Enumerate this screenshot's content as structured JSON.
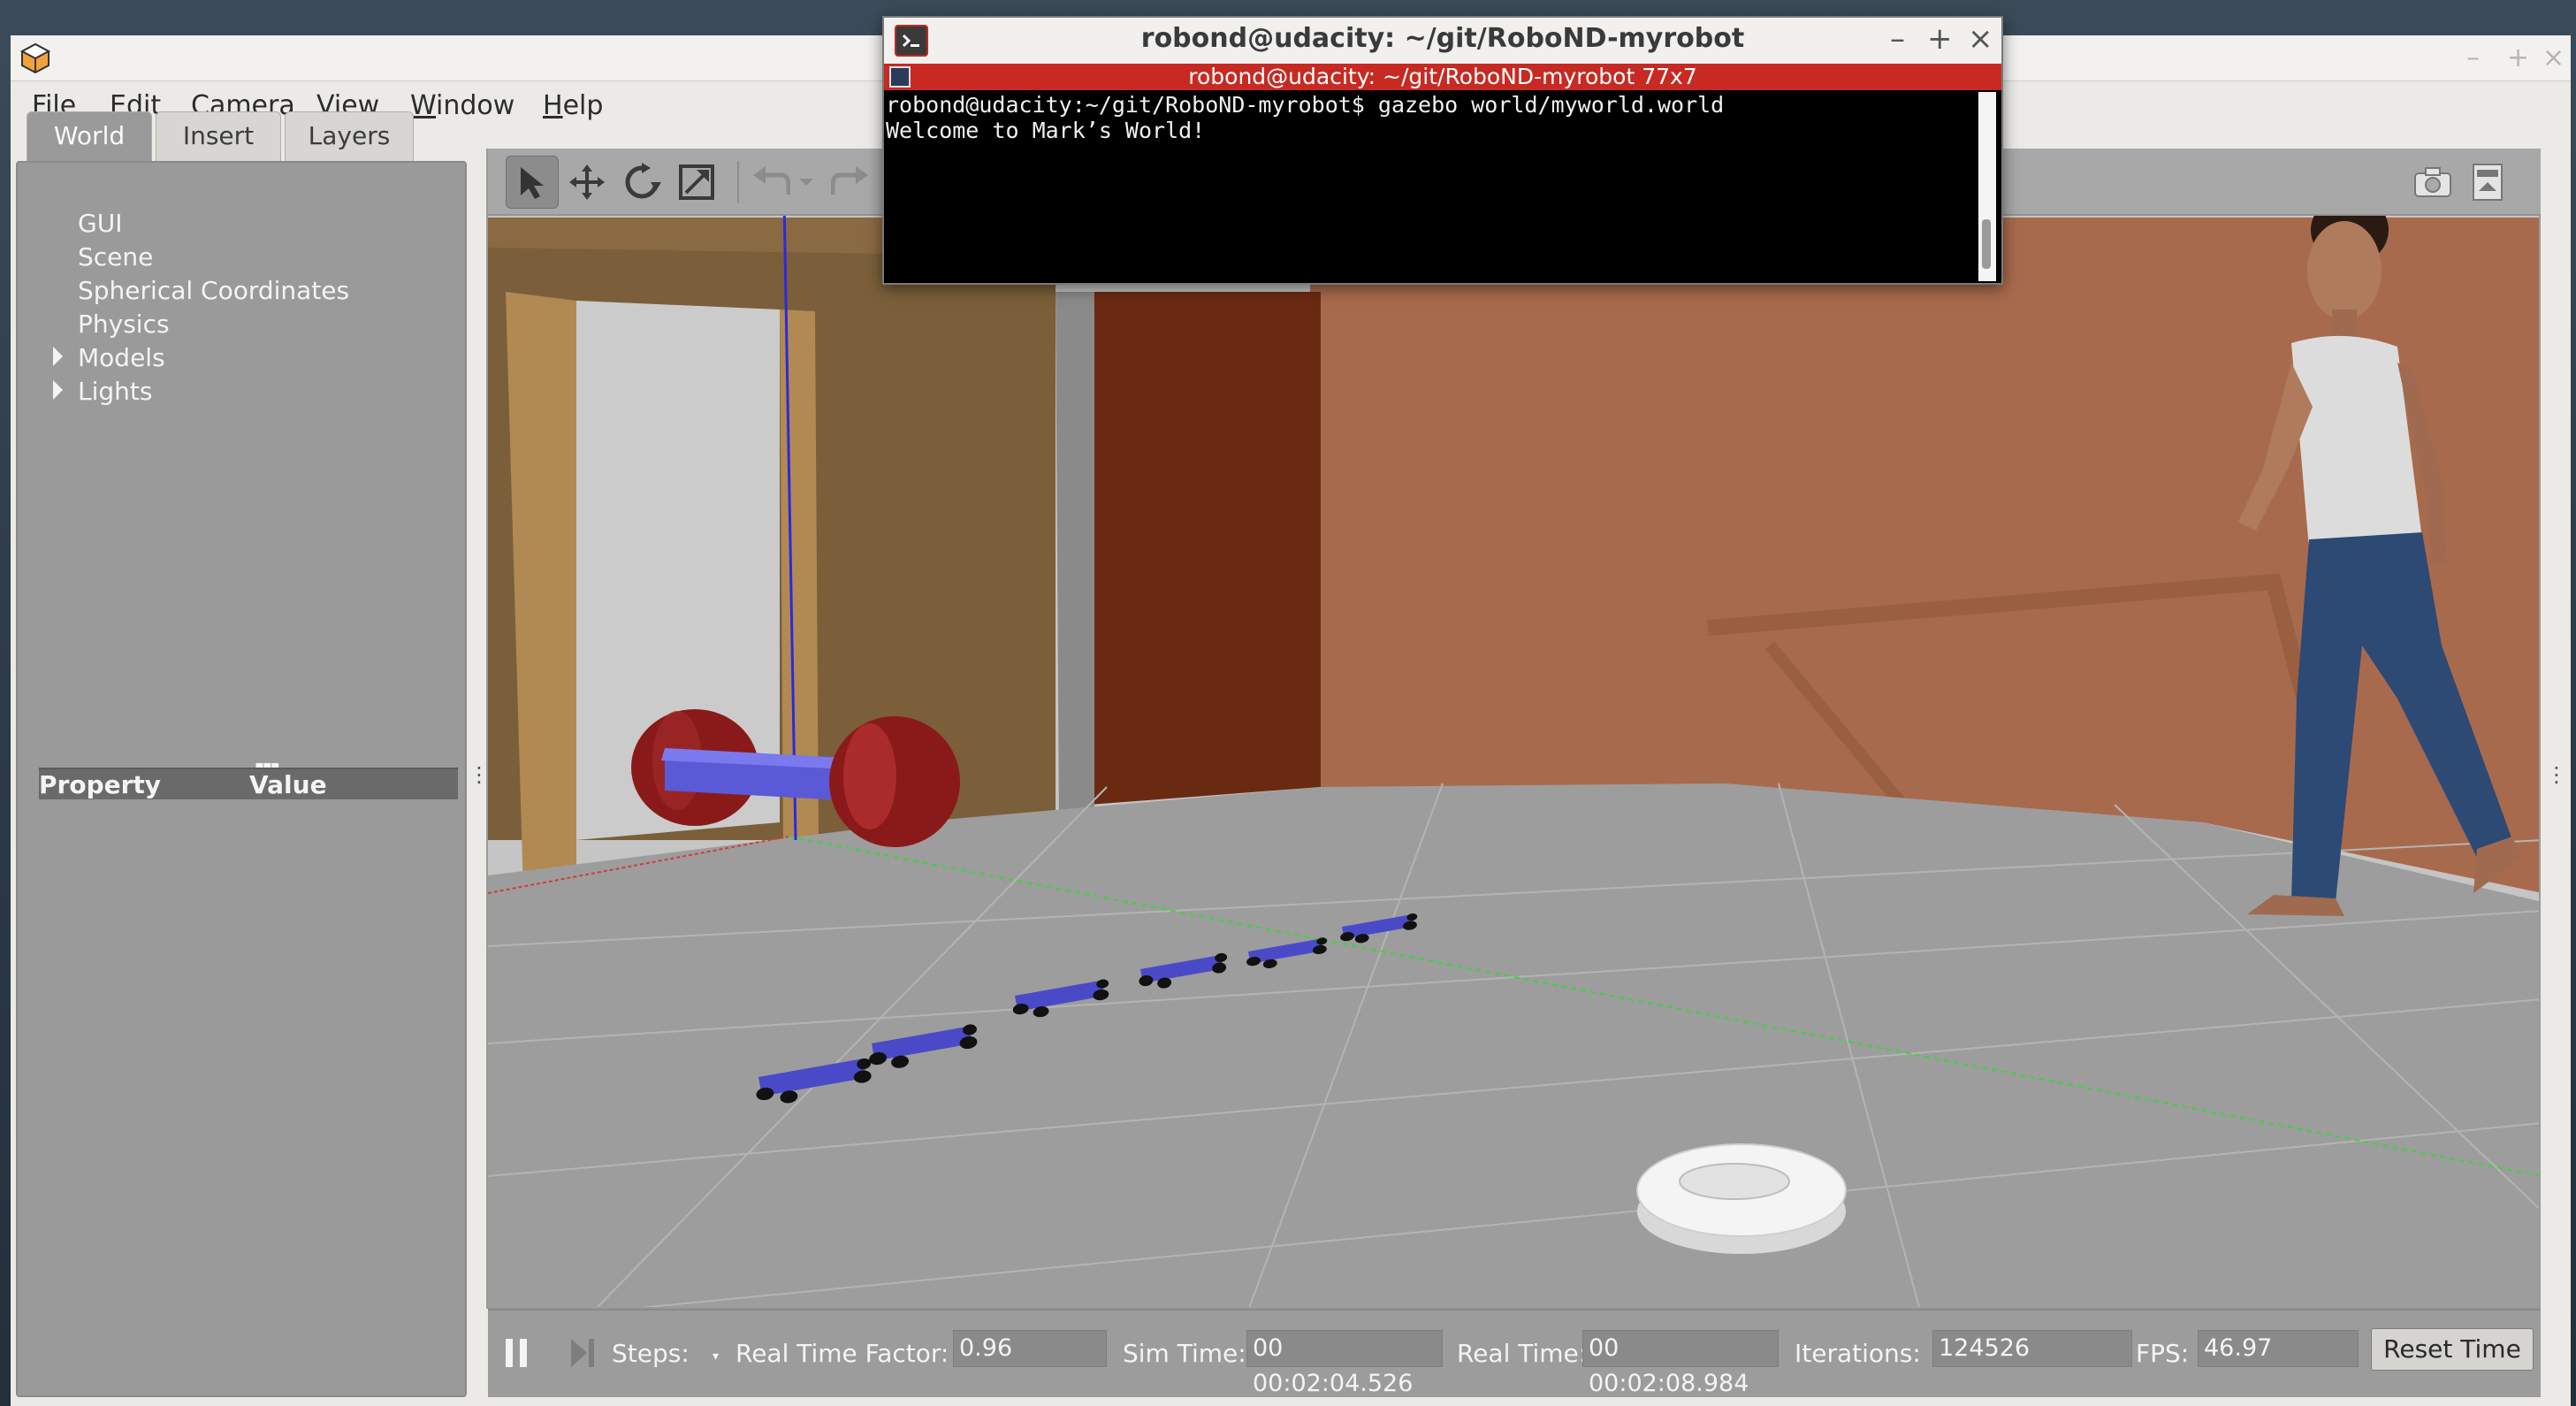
{
  "gazebo": {
    "menu": [
      "File",
      "Edit",
      "Camera",
      "View",
      "Window",
      "Help"
    ],
    "tabs": [
      "World",
      "Insert",
      "Layers"
    ],
    "tree": [
      "GUI",
      "Scene",
      "Spherical Coordinates",
      "Physics",
      "Models",
      "Lights"
    ],
    "properties": {
      "col1": "Property",
      "col2": "Value"
    },
    "status": {
      "steps_label": "Steps:",
      "rtf_label": "Real Time Factor:",
      "rtf_value": "0.96",
      "sim_time_label": "Sim Time:",
      "sim_time_value": "00 00:02:04.526",
      "real_time_label": "Real Time:",
      "real_time_value": "00 00:02:08.984",
      "iterations_label": "Iterations:",
      "iterations_value": "124526",
      "fps_label": "FPS:",
      "fps_value": "46.97",
      "reset_label": "Reset Time"
    }
  },
  "terminal": {
    "title": "robond@udacity: ~/git/RoboND-myrobot",
    "tab_title": "robond@udacity: ~/git/RoboND-myrobot 77x7",
    "lines": [
      "robond@udacity:~/git/RoboND-myrobot$ gazebo world/myworld.world",
      "Welcome to Mark’s World!"
    ]
  },
  "colors": {
    "terminal_tab": "#c72a22",
    "wall": "#a9694a",
    "floor": "#9e9e9e",
    "robot_body": "#5a5acc",
    "robot_wheel": "#8b1a1a"
  }
}
